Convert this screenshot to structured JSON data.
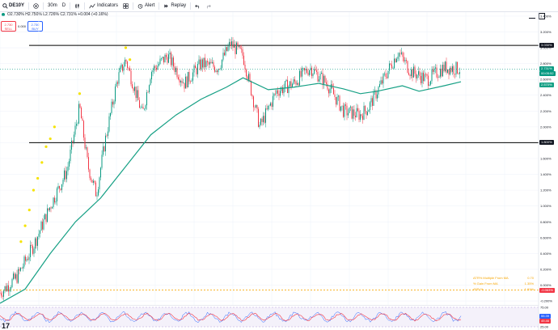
{
  "toolbar": {
    "symbol": "DE10Y",
    "interval": "30m",
    "chart_type_letter": "D",
    "indicators_label": "Indicators",
    "alert_label": "Alert",
    "replay_label": "Replay"
  },
  "legend": {
    "ohlc_text": "O2.730% H2.750% L2.726% C2.731% +0.004 (+0.16%)"
  },
  "trade": {
    "sell_price": "2.730",
    "sell_label": "SELL",
    "spread": "0.000",
    "buy_price": "2.730",
    "buy_label": "BUY"
  },
  "price_scale": {
    "ticks": [
      "3.400%",
      "3.200%",
      "3.000%",
      "2.800%",
      "2.600%",
      "2.400%",
      "2.200%",
      "2.000%",
      "1.800%",
      "1.600%",
      "1.400%",
      "1.200%",
      "1.000%",
      "0.800%",
      "0.600%",
      "0.400%",
      "0.200%",
      "0.000%",
      "-0.200%"
    ],
    "tag_upper_line": "3.030%",
    "tag_price": "2.731%",
    "tag_price_time": "00:05:52",
    "tag_ma": "2.570%",
    "tag_lower_line": "1.800%",
    "tag_zero": "-0.063%",
    "osc_ticks": [
      "75.00",
      "25.00"
    ],
    "osc_tag1": "55.39",
    "osc_tag2": "49.46"
  },
  "stats": {
    "rows": [
      {
        "label": "ATR% Multiple From MA",
        "value": "0.70"
      },
      {
        "label": "% Gain From MA",
        "value": "1.35%"
      },
      {
        "label": "ATR %",
        "value": "1.91%"
      }
    ]
  },
  "colors": {
    "up": "#089981",
    "down": "#f23645",
    "ma": "#16a085",
    "level_line": "#000000",
    "dotted": "#f7a600",
    "signal": "#f5e300",
    "osc_bg": "#ede7f6"
  },
  "chart_data": {
    "type": "line",
    "symbol": "DE10Y",
    "interval": "30m",
    "ylim": [
      -0.2,
      3.45
    ],
    "horizontal_levels": [
      3.03,
      1.8
    ],
    "zero_level": -0.063,
    "last_price": 2.731,
    "ma_last": 2.57,
    "price_path": [
      [
        0,
        -0.1
      ],
      [
        4,
        0.1
      ],
      [
        8,
        0.5
      ],
      [
        12,
        1.0
      ],
      [
        16,
        1.45
      ],
      [
        19,
        2.25
      ],
      [
        21,
        1.5
      ],
      [
        23,
        1.15
      ],
      [
        25,
        1.8
      ],
      [
        28,
        2.6
      ],
      [
        30,
        2.85
      ],
      [
        32,
        2.5
      ],
      [
        34,
        2.15
      ],
      [
        36,
        2.7
      ],
      [
        40,
        2.9
      ],
      [
        44,
        2.55
      ],
      [
        48,
        2.8
      ],
      [
        52,
        2.75
      ],
      [
        55,
        3.05
      ],
      [
        58,
        2.9
      ],
      [
        62,
        2.0
      ],
      [
        66,
        2.45
      ],
      [
        70,
        2.55
      ],
      [
        74,
        2.75
      ],
      [
        78,
        2.55
      ],
      [
        82,
        2.2
      ],
      [
        86,
        2.15
      ],
      [
        88,
        2.25
      ],
      [
        90,
        2.45
      ],
      [
        93,
        2.75
      ],
      [
        95,
        2.95
      ],
      [
        98,
        2.7
      ],
      [
        102,
        2.6
      ],
      [
        106,
        2.75
      ],
      [
        110,
        2.73
      ]
    ],
    "ma_path": [
      [
        0,
        -0.23
      ],
      [
        6,
        -0.05
      ],
      [
        12,
        0.4
      ],
      [
        18,
        0.8
      ],
      [
        24,
        1.1
      ],
      [
        30,
        1.5
      ],
      [
        36,
        1.9
      ],
      [
        42,
        2.15
      ],
      [
        48,
        2.35
      ],
      [
        54,
        2.5
      ],
      [
        58,
        2.62
      ],
      [
        64,
        2.47
      ],
      [
        70,
        2.5
      ],
      [
        76,
        2.55
      ],
      [
        82,
        2.48
      ],
      [
        86,
        2.42
      ],
      [
        90,
        2.45
      ],
      [
        96,
        2.52
      ],
      [
        100,
        2.45
      ],
      [
        106,
        2.52
      ],
      [
        110,
        2.57
      ]
    ]
  }
}
